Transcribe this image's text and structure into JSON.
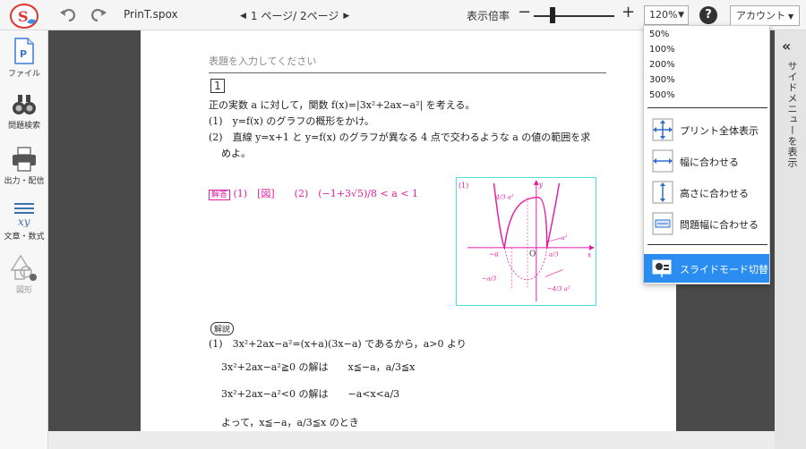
{
  "toolbar": {
    "filename": "PrinT.spox",
    "pager": "1 ページ/ 2ページ",
    "zoom_label": "表示倍率",
    "minus": "−",
    "plus": "+",
    "zoom_value": "120%",
    "help": "?",
    "account": "アカウント"
  },
  "sidebar": {
    "items": [
      {
        "label": "ファイル"
      },
      {
        "label": "問題検索"
      },
      {
        "label": "出力・配信"
      },
      {
        "label": "文章・数式"
      },
      {
        "label": "図形"
      }
    ]
  },
  "document": {
    "title_placeholder": "表題を入力してください",
    "problem_number": "1",
    "lines": [
      "正の実数 a に対して，関数 f(x)=|3x²+2ax−a²| を考える。",
      "(1)　y=f(x) のグラフの概形をかけ。",
      "(2)　直線 y=x+1 と y=f(x) のグラフが異なる 4 点で交わるような a の値の範囲を求",
      "めよ。"
    ],
    "answer_tag": "解答",
    "answer_text": "(1)　[図]　　(2)　(−1+3√5)/8 < a < 1",
    "explanation_tag": "解説",
    "expl_lines": [
      "(1)　3x²+2ax−a²=(x+a)(3x−a) であるから，a>0 より",
      "3x²+2ax−a²≧0 の解は　　x≦−a，a/3≦x",
      "3x²+2ax−a²<0 の解は　　−a<x<a/3",
      "よって，x≦−a，a/3≦x のとき"
    ],
    "graph_labels": {
      "panel": "(1)",
      "y": "y",
      "x": "x",
      "origin": "O",
      "neg_a": "−a",
      "a3": "a/3",
      "peak": "4/3 a²",
      "a2": "a²",
      "neg_a3": "−a/3",
      "neg_peak": "−4/3 a²"
    }
  },
  "sidemenu": {
    "toggle": "«",
    "label": "サイドメニューを表示"
  },
  "zoom_dropdown": {
    "options": [
      "50%",
      "100%",
      "200%",
      "300%",
      "500%"
    ],
    "actions": [
      "プリント全体表示",
      "幅に合わせる",
      "高さに合わせる",
      "問題幅に合わせる"
    ],
    "slide_mode": "スライドモード切替"
  },
  "colors": {
    "answer": "#e21ea5",
    "accent": "#2b8df0",
    "graph_border": "#4ee0e0"
  }
}
